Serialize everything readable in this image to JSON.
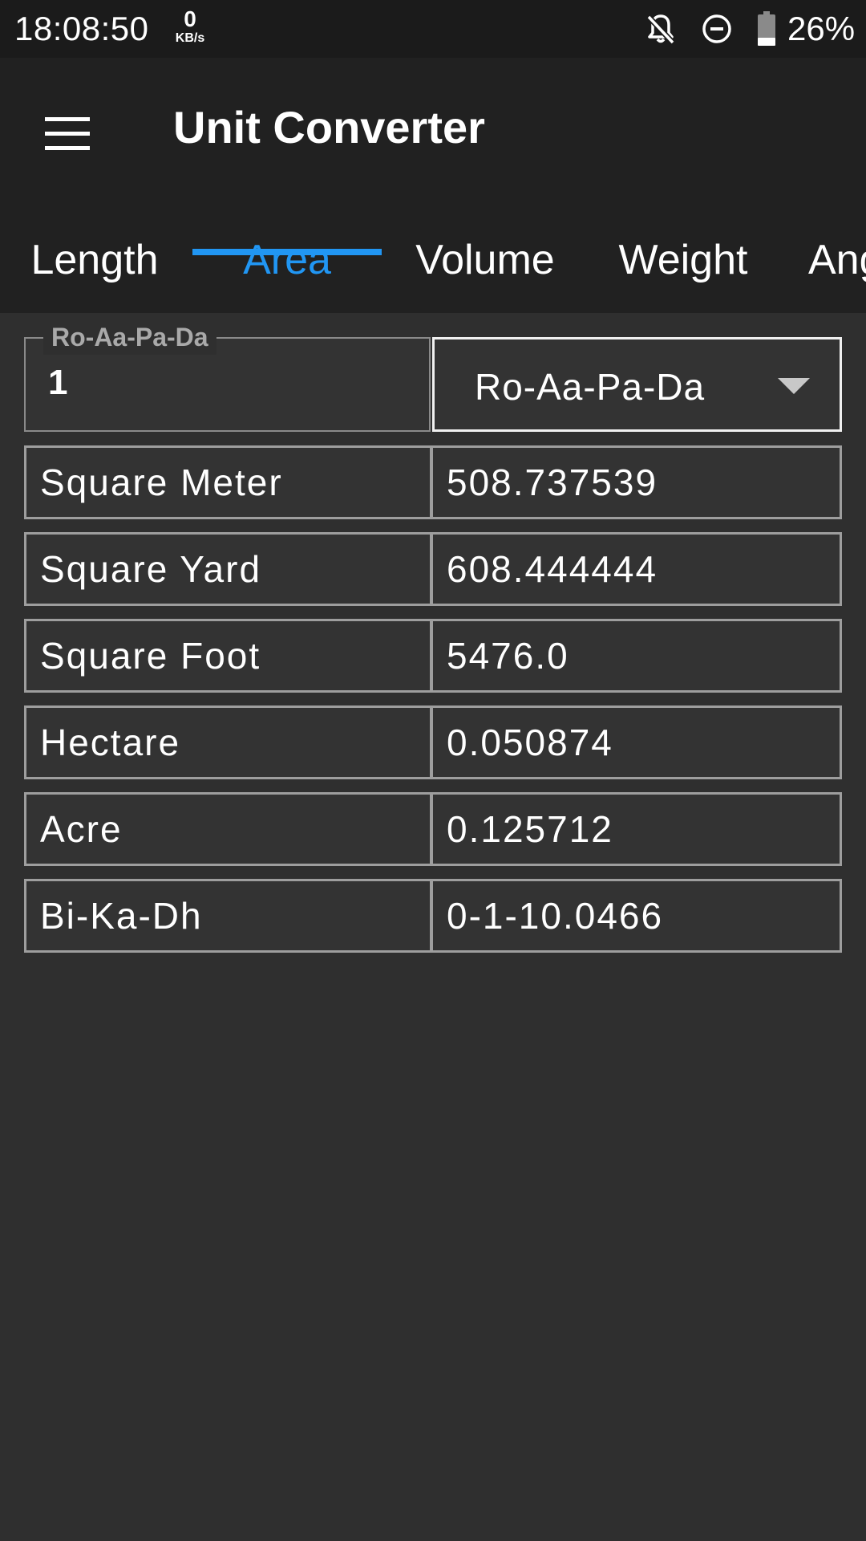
{
  "status_bar": {
    "time": "18:08:50",
    "net_speed_value": "0",
    "net_speed_unit": "KB/s",
    "icons": [
      "bell-off-icon",
      "do-not-disturb-icon",
      "battery-icon"
    ],
    "battery_percent": "26%"
  },
  "app_bar": {
    "title": "Unit Converter",
    "menu_icon": "hamburger-menu-icon"
  },
  "tabs": [
    {
      "label": "Length",
      "active": false
    },
    {
      "label": "Area",
      "active": true
    },
    {
      "label": "Volume",
      "active": false
    },
    {
      "label": "Weight",
      "active": false
    },
    {
      "label": "Ang",
      "active": false
    }
  ],
  "input": {
    "label": "Ro-Aa-Pa-Da",
    "value": "1"
  },
  "unit_select": {
    "selected": "Ro-Aa-Pa-Da",
    "icon": "dropdown-arrow-icon"
  },
  "results": [
    {
      "unit": "Square Meter",
      "value": "508.737539"
    },
    {
      "unit": "Square Yard",
      "value": "608.444444"
    },
    {
      "unit": "Square Foot",
      "value": "5476.0"
    },
    {
      "unit": "Hectare",
      "value": "0.050874"
    },
    {
      "unit": "Acre",
      "value": "0.125712"
    },
    {
      "unit": "Bi-Ka-Dh",
      "value": "0-1-10.0466"
    }
  ],
  "colors": {
    "accent": "#2196f3",
    "background": "#2f2f2f",
    "app_bar": "#212121",
    "status_bar": "#1b1b1b"
  }
}
